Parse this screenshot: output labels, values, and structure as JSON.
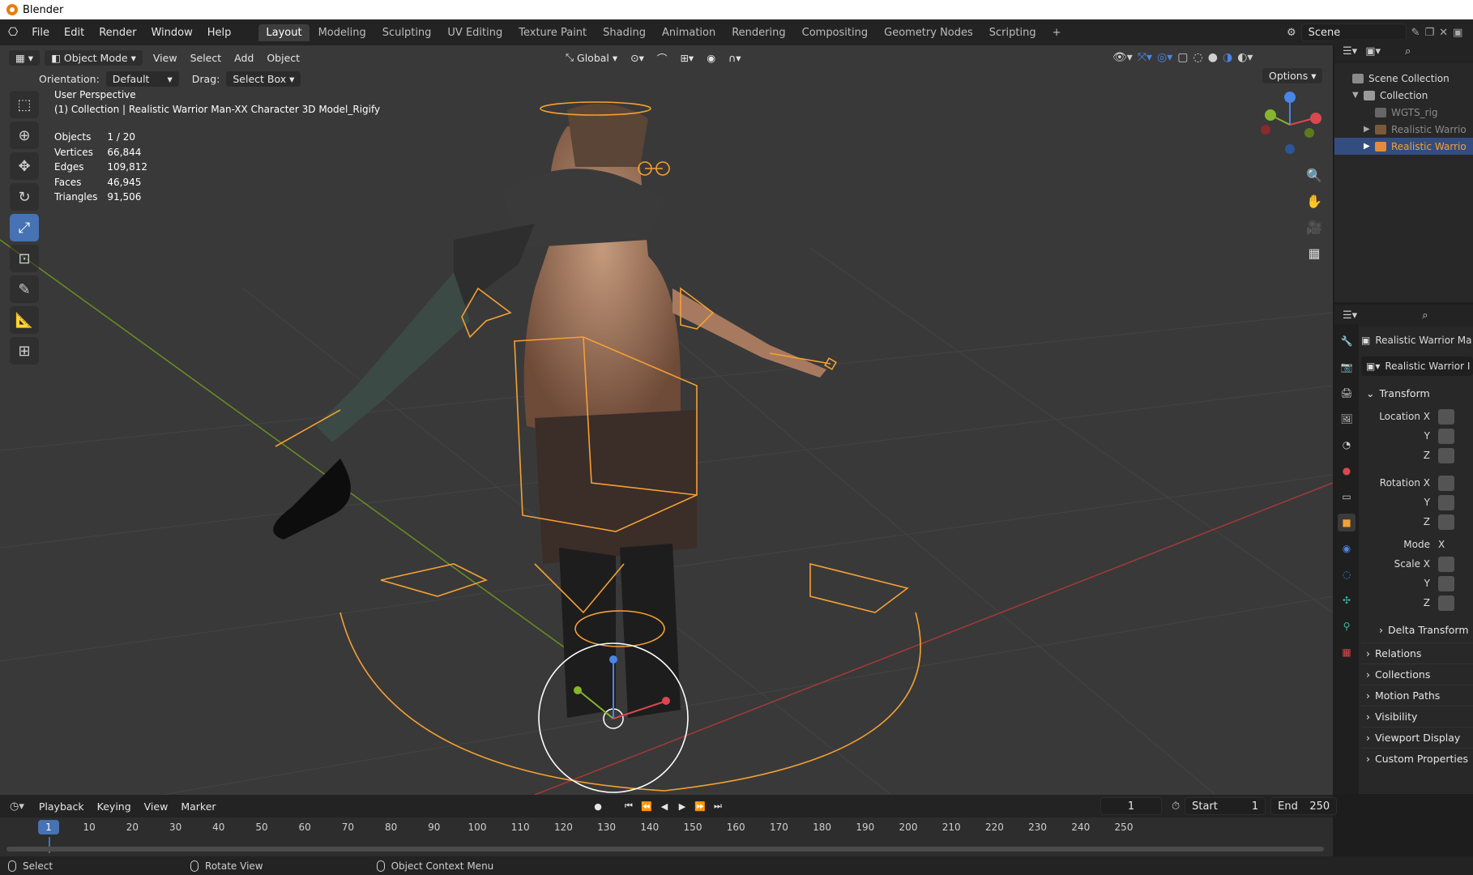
{
  "window": {
    "title": "Blender"
  },
  "menu": [
    "File",
    "Edit",
    "Render",
    "Window",
    "Help"
  ],
  "workspaces": [
    "Layout",
    "Modeling",
    "Sculpting",
    "UV Editing",
    "Texture Paint",
    "Shading",
    "Animation",
    "Rendering",
    "Compositing",
    "Geometry Nodes",
    "Scripting",
    "+"
  ],
  "active_workspace": "Layout",
  "scene": {
    "name": "Scene"
  },
  "viewport_header": {
    "mode": "Object Mode",
    "menus": [
      "View",
      "Select",
      "Add",
      "Object"
    ],
    "transform_orientation": "Global"
  },
  "tool_settings": {
    "orientation_label": "Orientation:",
    "orientation_value": "Default",
    "drag_label": "Drag:",
    "drag_value": "Select Box",
    "options": "Options"
  },
  "viewport_info": {
    "perspective": "User Perspective",
    "collection_line": "(1) Collection | Realistic Warrior Man-XX Character 3D Model_Rigify"
  },
  "stats": [
    {
      "label": "Objects",
      "value": "1 / 20"
    },
    {
      "label": "Vertices",
      "value": "66,844"
    },
    {
      "label": "Edges",
      "value": "109,812"
    },
    {
      "label": "Faces",
      "value": "46,945"
    },
    {
      "label": "Triangles",
      "value": "91,506"
    }
  ],
  "outliner": {
    "rows": [
      {
        "label": "Scene Collection"
      },
      {
        "label": "Collection"
      },
      {
        "label": "WGTS_rig"
      },
      {
        "label": "Realistic Warrio"
      },
      {
        "label": "Realistic Warrio"
      }
    ]
  },
  "properties": {
    "object_name": "Realistic Warrior Ma",
    "data_name": "Realistic Warrior I",
    "transform_header": "Transform",
    "location_labels": [
      "Location X",
      "Y",
      "Z"
    ],
    "rotation_labels": [
      "Rotation X",
      "Y",
      "Z"
    ],
    "mode_label": "Mode",
    "mode_value": "X",
    "scale_labels": [
      "Scale X",
      "Y",
      "Z"
    ],
    "subpanels": [
      "Delta Transform",
      "Relations",
      "Collections",
      "Motion Paths",
      "Visibility",
      "Viewport Display",
      "Custom Properties"
    ]
  },
  "timeline": {
    "menus": [
      "Playback",
      "Keying",
      "View",
      "Marker"
    ],
    "current_frame": "1",
    "start_label": "Start",
    "start_value": "1",
    "end_label": "End",
    "end_value": "250",
    "ruler_current": "1",
    "ruler_ticks": [
      "10",
      "20",
      "30",
      "40",
      "50",
      "60",
      "70",
      "80",
      "90",
      "100",
      "110",
      "120",
      "130",
      "140",
      "150",
      "160",
      "170",
      "180",
      "190",
      "200",
      "210",
      "220",
      "230",
      "240",
      "250"
    ]
  },
  "statusbar": {
    "items": [
      "Select",
      "Rotate View",
      "Object Context Menu"
    ]
  },
  "colors": {
    "selection_orange": "#f5a033",
    "active_blue": "#4772b3",
    "x_axis": "#d9484f",
    "y_axis": "#86b62a",
    "z_axis": "#4a85e8"
  }
}
